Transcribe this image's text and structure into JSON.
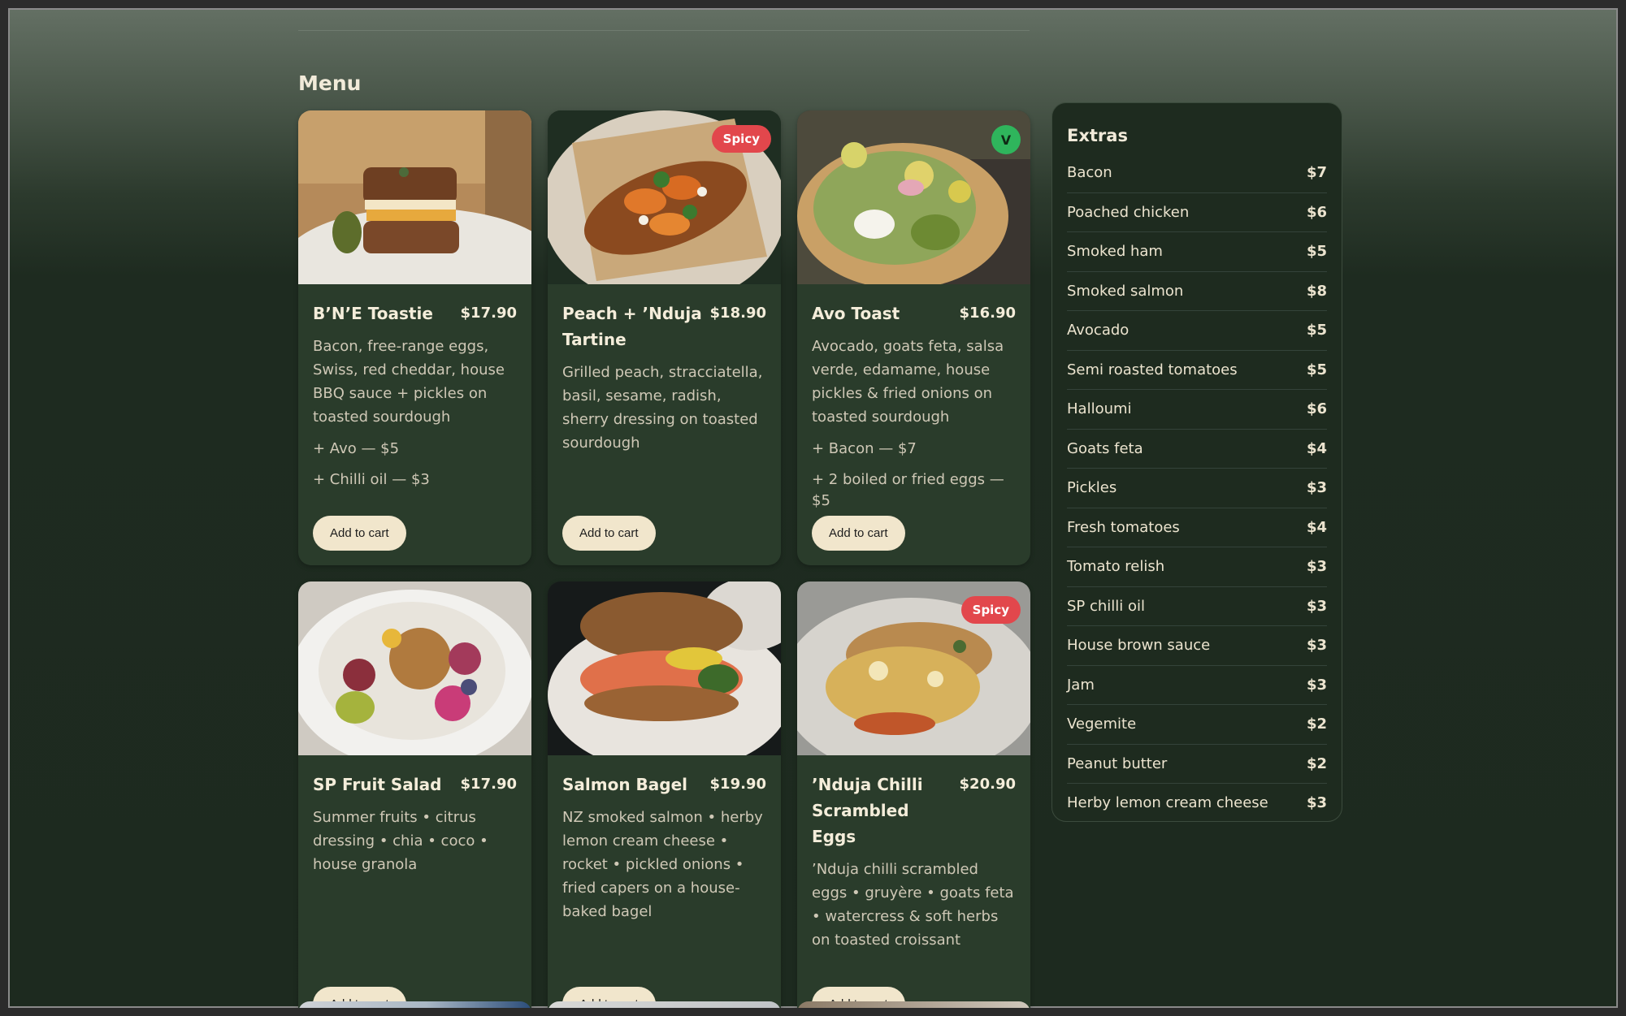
{
  "menu": {
    "title": "Menu",
    "add_to_cart_label": "Add to cart",
    "items": [
      {
        "name": "B’N’E Toastie",
        "price": "$17.90",
        "description": "Bacon, free-range eggs, Swiss, red cheddar, house BBQ sauce + pickles on toasted sourdough",
        "addons": [
          "+ Avo — $5",
          "+ Chilli oil — $3"
        ],
        "badge": ""
      },
      {
        "name": "Peach + ’Nduja Tartine",
        "price": "$18.90",
        "description": "Grilled peach, stracciatella, basil, sesame, radish, sherry dressing on toasted sourdough",
        "addons": [],
        "badge": "Spicy"
      },
      {
        "name": "Avo Toast",
        "price": "$16.90",
        "description": "Avocado, goats feta, salsa verde, edamame, house pickles & fried onions on toasted sourdough",
        "addons": [
          "+ Bacon — $7",
          "+ 2 boiled or fried eggs — $5"
        ],
        "badge": "V"
      },
      {
        "name": "SP Fruit Salad",
        "price": "$17.90",
        "description": "Summer fruits • citrus dressing • chia • coco • house granola",
        "addons": [],
        "badge": ""
      },
      {
        "name": "Salmon Bagel",
        "price": "$19.90",
        "description": "NZ smoked salmon • herby lemon cream cheese • rocket • pickled onions • fried capers on a house-baked bagel",
        "addons": [],
        "badge": ""
      },
      {
        "name": "’Nduja Chilli Scrambled Eggs",
        "price": "$20.90",
        "description": "’Nduja chilli scrambled eggs • gruyère • goats feta • watercress & soft herbs on toasted croissant",
        "addons": [],
        "badge": "Spicy"
      }
    ]
  },
  "extras": {
    "title": "Extras",
    "items": [
      {
        "name": "Bacon",
        "price": "$7"
      },
      {
        "name": "Poached chicken",
        "price": "$6"
      },
      {
        "name": "Smoked ham",
        "price": "$5"
      },
      {
        "name": "Smoked salmon",
        "price": "$8"
      },
      {
        "name": "Avocado",
        "price": "$5"
      },
      {
        "name": "Semi roasted tomatoes",
        "price": "$5"
      },
      {
        "name": "Halloumi",
        "price": "$6"
      },
      {
        "name": "Goats feta",
        "price": "$4"
      },
      {
        "name": "Pickles",
        "price": "$3"
      },
      {
        "name": "Fresh tomatoes",
        "price": "$4"
      },
      {
        "name": "Tomato relish",
        "price": "$3"
      },
      {
        "name": "SP chilli oil",
        "price": "$3"
      },
      {
        "name": "House brown sauce",
        "price": "$3"
      },
      {
        "name": "Jam",
        "price": "$3"
      },
      {
        "name": "Vegemite",
        "price": "$2"
      },
      {
        "name": "Peanut butter",
        "price": "$2"
      },
      {
        "name": "Herby lemon cream cheese",
        "price": "$3"
      }
    ]
  },
  "colors": {
    "card_bg": "#2a3c2b",
    "spicy_badge": "#e2474c",
    "veg_badge": "#2fb55c",
    "button_bg": "#f1e6cc"
  }
}
